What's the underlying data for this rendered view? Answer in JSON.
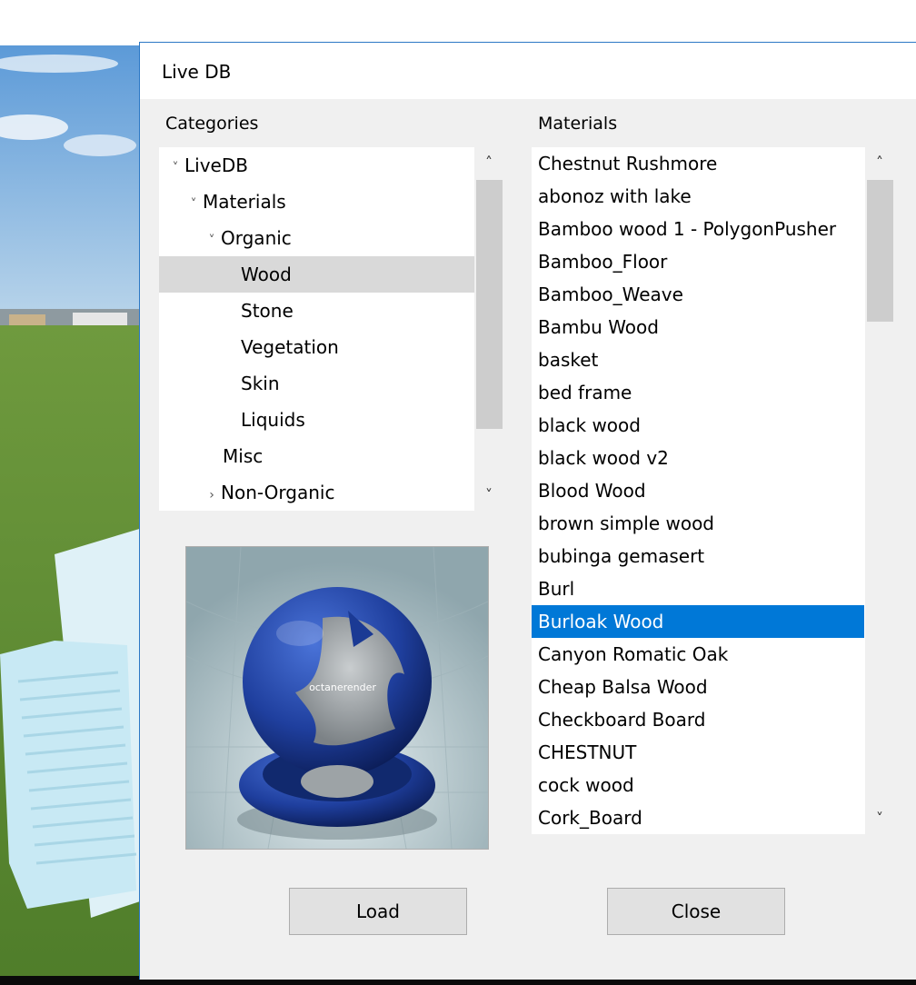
{
  "dialog": {
    "title": "Live DB",
    "categories_label": "Categories",
    "materials_label": "Materials"
  },
  "tree": {
    "items": [
      {
        "label": "LiveDB",
        "arrow": "chevron-down",
        "level": 0
      },
      {
        "label": "Materials",
        "arrow": "chevron-down",
        "level": 1
      },
      {
        "label": "Organic",
        "arrow": "chevron-down",
        "level": 2
      },
      {
        "label": "Wood",
        "arrow": "",
        "level": 3,
        "selected": true
      },
      {
        "label": "Stone",
        "arrow": "",
        "level": 3
      },
      {
        "label": "Vegetation",
        "arrow": "",
        "level": 3
      },
      {
        "label": "Skin",
        "arrow": "",
        "level": 3
      },
      {
        "label": "Liquids",
        "arrow": "",
        "level": 3
      },
      {
        "label": "Misc",
        "arrow": "",
        "level": 2
      },
      {
        "label": "Non-Organic",
        "arrow": "chevron-right",
        "level": 2
      }
    ]
  },
  "materials": {
    "items": [
      "Chestnut Rushmore",
      "abonoz with lake",
      "Bamboo wood 1 - PolygonPusher",
      "Bamboo_Floor",
      "Bamboo_Weave",
      "Bambu Wood",
      "basket",
      "bed frame",
      "black wood",
      "black wood v2",
      "Blood Wood",
      "brown simple wood",
      "bubinga gemasert",
      "Burl",
      "Burloak Wood",
      "Canyon Romatic Oak",
      "Cheap Balsa Wood",
      "Checkboard Board",
      "CHESTNUT",
      "cock wood",
      "Cork_Board"
    ],
    "selected": "Burloak Wood"
  },
  "preview": {
    "watermark": "octanerender"
  },
  "buttons": {
    "load_label": "Load",
    "close_label": "Close"
  },
  "colors": {
    "selection": "#0078d7",
    "tree_selection": "#d9d9d9",
    "material_blue": "#1f3f9e"
  }
}
